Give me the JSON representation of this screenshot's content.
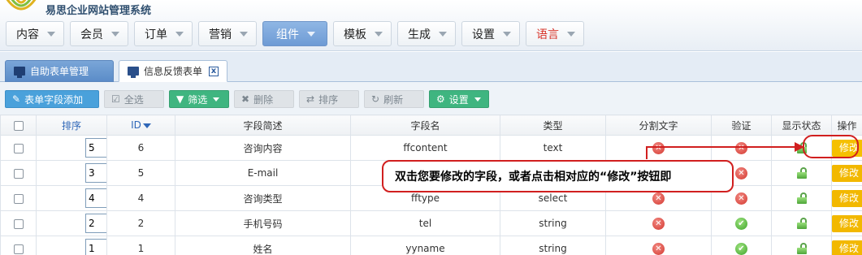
{
  "app": {
    "brand": "易思企业网站管理系统"
  },
  "topnav": [
    {
      "label": "内容",
      "active": false
    },
    {
      "label": "会员",
      "active": false
    },
    {
      "label": "订单",
      "active": false
    },
    {
      "label": "营销",
      "active": false
    },
    {
      "label": "组件",
      "active": true
    },
    {
      "label": "模板",
      "active": false
    },
    {
      "label": "生成",
      "active": false
    },
    {
      "label": "设置",
      "active": false
    },
    {
      "label": "语言",
      "active": false,
      "color": "#d8342a"
    }
  ],
  "tabs": [
    {
      "label": "自助表单管理",
      "active": false
    },
    {
      "label": "信息反馈表单",
      "active": true,
      "close": "x"
    }
  ],
  "toolbar": {
    "add": "表单字段添加",
    "select_all": "全选",
    "filter": "筛选",
    "delete": "删除",
    "sort": "排序",
    "refresh": "刷新",
    "settings": "设置"
  },
  "table": {
    "headers": {
      "sort": "排序",
      "id": "ID",
      "desc": "字段简述",
      "name": "字段名",
      "type": "类型",
      "split": "分割文字",
      "verify": "验证",
      "status": "显示状态",
      "action": "操作"
    },
    "rows": [
      {
        "sort": "5",
        "id": "6",
        "desc": "咨询内容",
        "name": "ffcontent",
        "type": "text",
        "split": false,
        "verify": false,
        "status": "unlocked",
        "action": "修改"
      },
      {
        "sort": "3",
        "id": "5",
        "desc": "E-mail",
        "name": "",
        "type": "",
        "split": false,
        "verify": false,
        "status": "unlocked",
        "action": "修改"
      },
      {
        "sort": "4",
        "id": "4",
        "desc": "咨询类型",
        "name": "fftype",
        "type": "select",
        "split": false,
        "verify": false,
        "status": "unlocked",
        "action": "修改"
      },
      {
        "sort": "2",
        "id": "2",
        "desc": "手机号码",
        "name": "tel",
        "type": "string",
        "split": false,
        "verify": true,
        "status": "unlocked",
        "action": "修改"
      },
      {
        "sort": "1",
        "id": "1",
        "desc": "姓名",
        "name": "yyname",
        "type": "string",
        "split": false,
        "verify": true,
        "status": "unlocked",
        "action": "修改"
      }
    ]
  },
  "annotation": {
    "text": "双击您要修改的字段，或者点击相对应的“修改”按钮即"
  },
  "colors": {
    "accent_blue": "#4aa1db",
    "filter_green": "#3fb580",
    "edit_yellow": "#f2b800",
    "annotation_red": "#d11f1f"
  }
}
